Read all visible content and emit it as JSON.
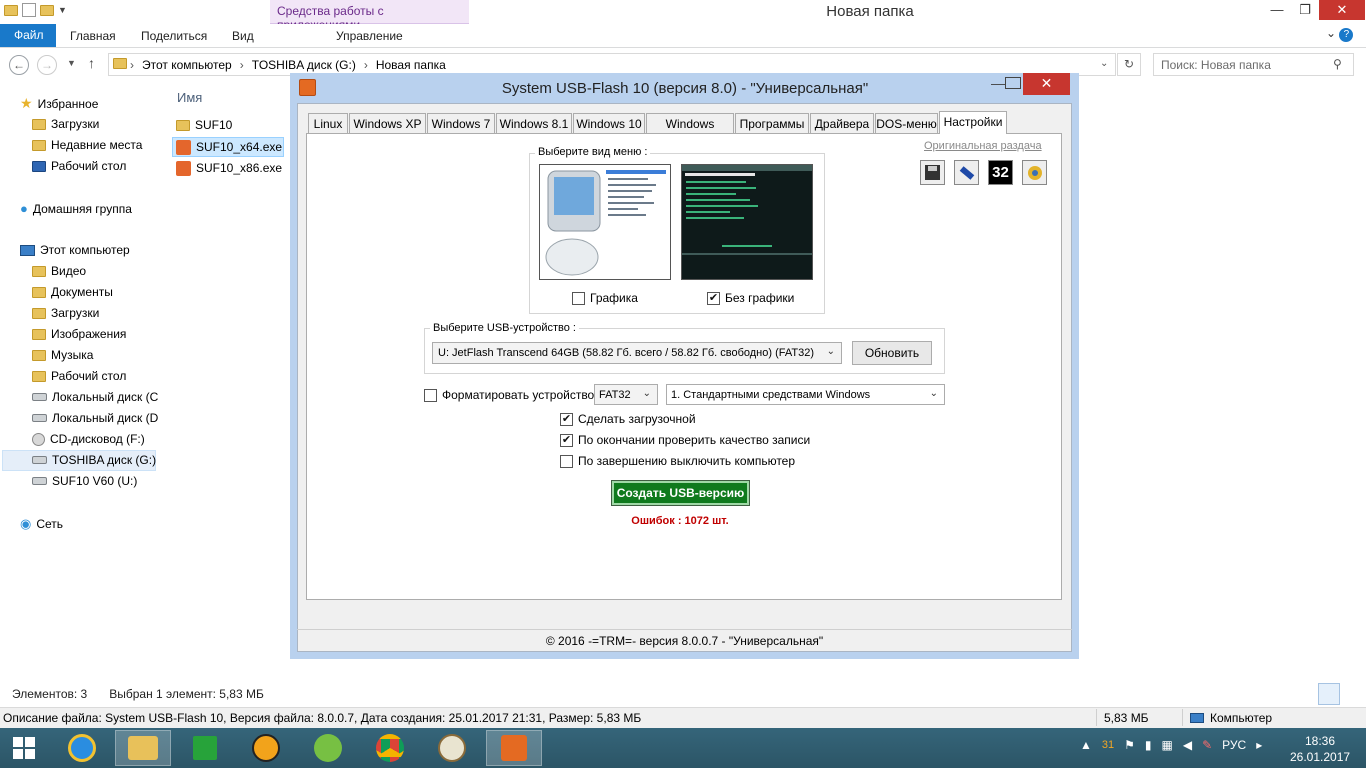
{
  "explorer": {
    "context_tab": "Средства работы с приложениями",
    "title": "Новая папка",
    "ribbon": {
      "file": "Файл",
      "tabs": [
        "Главная",
        "Поделиться",
        "Вид"
      ],
      "manage": "Управление"
    },
    "address": [
      "Этот компьютер",
      "TOSHIBA  диск (G:)",
      "Новая папка"
    ],
    "search_placeholder": "Поиск: Новая папка",
    "nav": {
      "favorites": "Избранное",
      "downloads": "Загрузки",
      "recent": "Недавние места",
      "desktop": "Рабочий стол",
      "homegroup": "Домашняя группа",
      "this_pc": "Этот компьютер",
      "video": "Видео",
      "documents": "Документы",
      "downloads2": "Загрузки",
      "images": "Изображения",
      "music": "Музыка",
      "desktop2": "Рабочий стол",
      "local_c": "Локальный диск (C",
      "local_d": "Локальный диск (D",
      "cd": "CD-дисковод (F:)",
      "toshiba": "TOSHIBA  диск (G:)",
      "suf": "SUF10 V60 (U:)",
      "network": "Сеть"
    },
    "column_name": "Имя",
    "files": [
      "SUF10",
      "SUF10_x64.exe",
      "SUF10_x86.exe"
    ],
    "status": {
      "count": "Элементов: 3",
      "selected": "Выбран 1 элемент: 5,83 МБ"
    },
    "details": {
      "description": "Описание файла: System USB-Flash 10, Версия файла: 8.0.0.7, Дата создания: 25.01.2017 21:31, Размер: 5,83 МБ",
      "size": "5,83 МБ",
      "location": "Компьютер"
    }
  },
  "dialog": {
    "title": "System USB-Flash 10 (версия 8.0) - \"Универсальная\"",
    "tabs": [
      "Linux",
      "Windows XP",
      "Windows 7",
      "Windows 8.1",
      "Windows 10",
      "Windows Server",
      "Программы",
      "Драйвера",
      "DOS-меню",
      "Настройки"
    ],
    "original_link": "Оригинальная раздача",
    "toolbar_badge": "32",
    "menu_group_label": "Выберите вид меню :",
    "opt_graphics": "Графика",
    "opt_nographics": "Без графики",
    "usb_group_label": "Выберите USB-устройство :",
    "usb_device": "U: JetFlash Transcend 64GB (58.82 Гб. всего / 58.82 Гб. свободно) (FAT32)",
    "refresh": "Обновить",
    "format_label": "Форматировать устройство :",
    "fs": "FAT32",
    "method": "1. Стандартными средствами Windows",
    "make_bootable": "Сделать загрузочной",
    "verify": "По окончании проверить качество записи",
    "shutdown": "По завершению выключить компьютер",
    "create": "Создать USB-версию",
    "errors": "Ошибок : 1072 шт.",
    "footer": "© 2016 -=TRM=- версия 8.0.0.7 - \"Универсальная\""
  },
  "taskbar": {
    "lang": "РУС",
    "time": "18:36",
    "date": "26.01.2017",
    "tray_badge": "31"
  }
}
